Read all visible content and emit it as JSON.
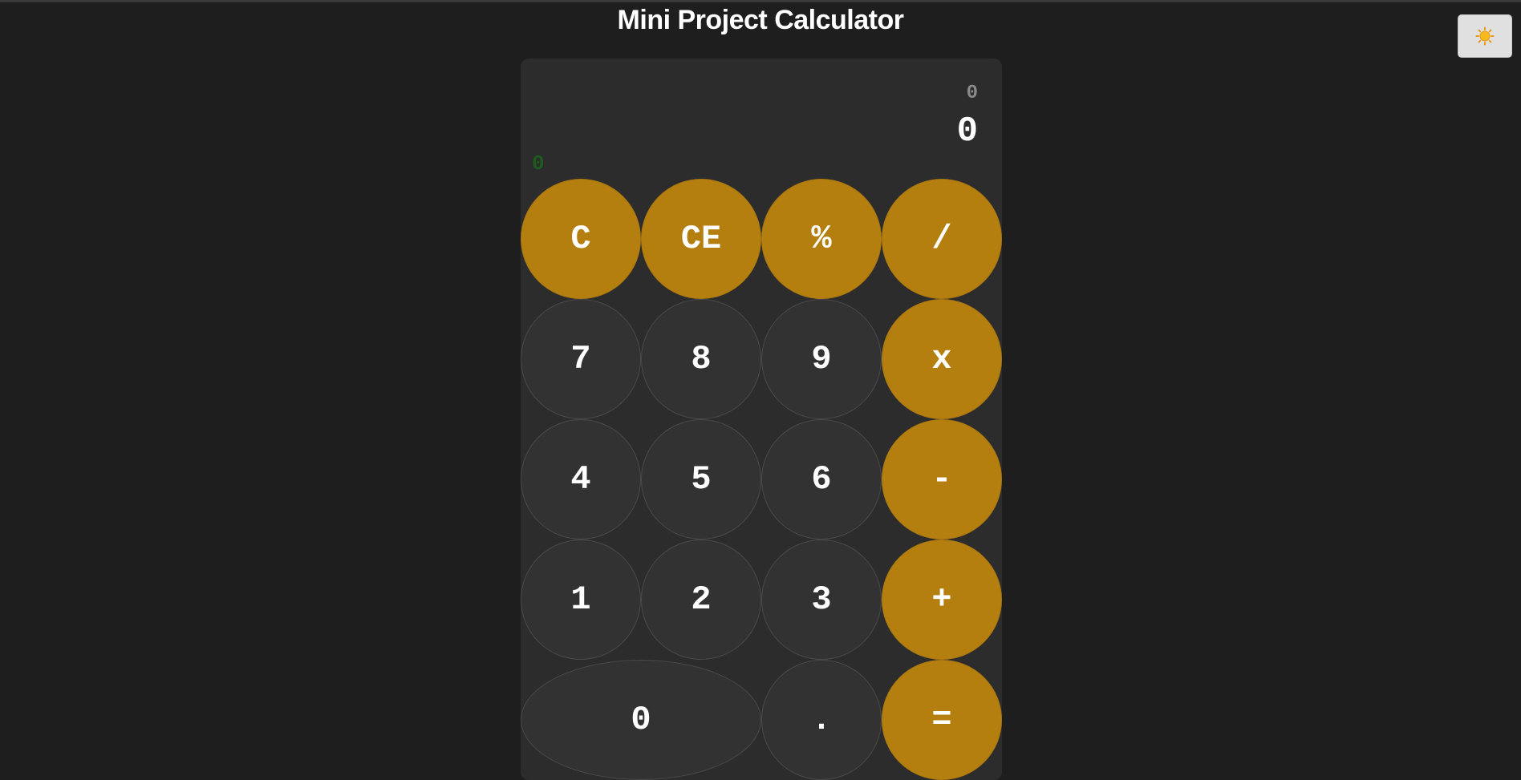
{
  "app": {
    "title": "Mini Project Calculator"
  },
  "theme_toggle": {
    "icon": "sun-icon"
  },
  "display": {
    "previous": "0",
    "current": "0",
    "memory": "0"
  },
  "keys": [
    {
      "id": "clear",
      "label": "C",
      "kind": "op"
    },
    {
      "id": "clear-entry",
      "label": "CE",
      "kind": "op"
    },
    {
      "id": "percent",
      "label": "%",
      "kind": "op"
    },
    {
      "id": "divide",
      "label": "/",
      "kind": "op"
    },
    {
      "id": "digit-7",
      "label": "7",
      "kind": "num"
    },
    {
      "id": "digit-8",
      "label": "8",
      "kind": "num"
    },
    {
      "id": "digit-9",
      "label": "9",
      "kind": "num"
    },
    {
      "id": "multiply",
      "label": "x",
      "kind": "op"
    },
    {
      "id": "digit-4",
      "label": "4",
      "kind": "num"
    },
    {
      "id": "digit-5",
      "label": "5",
      "kind": "num"
    },
    {
      "id": "digit-6",
      "label": "6",
      "kind": "num"
    },
    {
      "id": "subtract",
      "label": "-",
      "kind": "op"
    },
    {
      "id": "digit-1",
      "label": "1",
      "kind": "num"
    },
    {
      "id": "digit-2",
      "label": "2",
      "kind": "num"
    },
    {
      "id": "digit-3",
      "label": "3",
      "kind": "num"
    },
    {
      "id": "add",
      "label": "+",
      "kind": "op"
    },
    {
      "id": "digit-0",
      "label": "0",
      "kind": "num",
      "wide": true
    },
    {
      "id": "decimal",
      "label": ".",
      "kind": "num"
    },
    {
      "id": "equals",
      "label": "=",
      "kind": "op"
    }
  ],
  "colors": {
    "background": "#1e1e1e",
    "panel": "#2c2c2c",
    "number_key": "#323232",
    "operator_key": "#b57f10",
    "memory_text": "#1f5a1f"
  }
}
